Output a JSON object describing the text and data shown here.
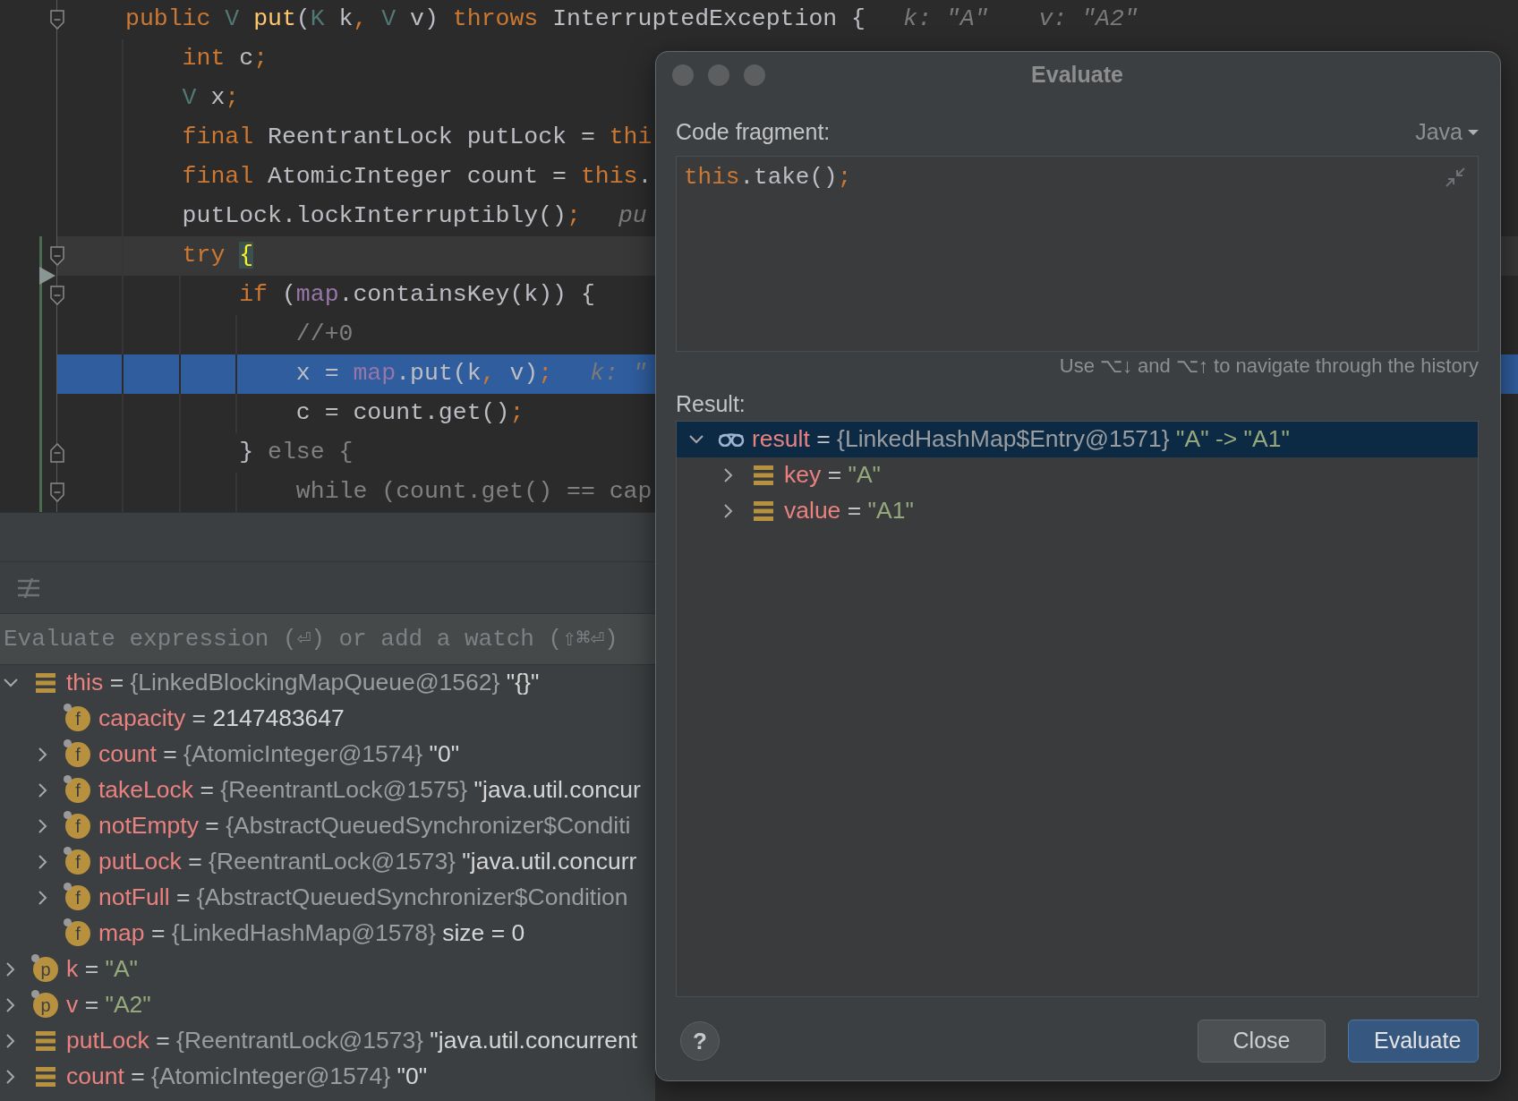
{
  "editor": {
    "lines": [
      {
        "tokens": [
          {
            "kind": "keyword",
            "text": "public "
          },
          {
            "kind": "type",
            "text": "V "
          },
          {
            "kind": "method",
            "text": "put"
          },
          {
            "kind": "plain",
            "text": "("
          },
          {
            "kind": "type",
            "text": "K"
          },
          {
            "kind": "plain",
            "text": " k"
          },
          {
            "kind": "punct",
            "text": ", "
          },
          {
            "kind": "type",
            "text": "V"
          },
          {
            "kind": "plain",
            "text": " v) "
          },
          {
            "kind": "keyword",
            "text": "throws"
          },
          {
            "kind": "plain",
            "text": " InterruptedException {"
          }
        ],
        "hints": [
          "k: \"A\"",
          "v: \"A2\""
        ],
        "fold_start": true,
        "fold_end": false,
        "current": false,
        "caret": false,
        "exec": false,
        "changed": false
      },
      {
        "tokens": [
          {
            "kind": "keyword",
            "text": "    int"
          },
          {
            "kind": "plain",
            "text": " c"
          },
          {
            "kind": "punct",
            "text": ";"
          }
        ],
        "fold_start": false,
        "fold_end": false,
        "current": false,
        "caret": false,
        "exec": false,
        "changed": false
      },
      {
        "tokens": [
          {
            "kind": "type",
            "text": "    V"
          },
          {
            "kind": "plain",
            "text": " x"
          },
          {
            "kind": "punct",
            "text": ";"
          }
        ],
        "fold_start": false,
        "fold_end": false,
        "current": false,
        "caret": false,
        "exec": false,
        "changed": false
      },
      {
        "tokens": [
          {
            "kind": "keyword",
            "text": "    final"
          },
          {
            "kind": "plain",
            "text": " ReentrantLock putLock = "
          },
          {
            "kind": "keyword",
            "text": "thi"
          }
        ],
        "fold_start": false,
        "fold_end": false,
        "current": false,
        "caret": false,
        "exec": false,
        "changed": false
      },
      {
        "tokens": [
          {
            "kind": "keyword",
            "text": "    final"
          },
          {
            "kind": "plain",
            "text": " AtomicInteger count = "
          },
          {
            "kind": "keyword",
            "text": "this"
          },
          {
            "kind": "plain",
            "text": "."
          }
        ],
        "fold_start": false,
        "fold_end": false,
        "current": false,
        "caret": false,
        "exec": false,
        "changed": false
      },
      {
        "tokens": [
          {
            "kind": "plain",
            "text": "    putLock.lockInterruptibly()"
          },
          {
            "kind": "punct",
            "text": ";"
          }
        ],
        "hints": [
          "pu"
        ],
        "fold_start": false,
        "fold_end": false,
        "current": false,
        "caret": false,
        "exec": false,
        "changed": false
      },
      {
        "tokens": [
          {
            "kind": "keyword",
            "text": "    try "
          },
          {
            "kind": "brace",
            "text": "{"
          }
        ],
        "fold_start": true,
        "fold_end": false,
        "current": false,
        "caret": true,
        "exec": true,
        "changed": true
      },
      {
        "tokens": [
          {
            "kind": "keyword",
            "text": "        if"
          },
          {
            "kind": "plain",
            "text": " ("
          },
          {
            "kind": "field",
            "text": "map"
          },
          {
            "kind": "plain",
            "text": ".containsKey(k)) {"
          }
        ],
        "fold_start": true,
        "fold_end": false,
        "current": false,
        "caret": false,
        "exec": false,
        "changed": true
      },
      {
        "tokens": [
          {
            "kind": "comment",
            "text": "            //+0"
          }
        ],
        "fold_start": false,
        "fold_end": false,
        "current": false,
        "caret": false,
        "exec": false,
        "changed": true
      },
      {
        "tokens": [
          {
            "kind": "plain",
            "text": "            x = "
          },
          {
            "kind": "field",
            "text": "map"
          },
          {
            "kind": "plain",
            "text": ".put(k"
          },
          {
            "kind": "punct",
            "text": ","
          },
          {
            "kind": "plain",
            "text": " v)"
          },
          {
            "kind": "punct",
            "text": ";"
          }
        ],
        "hints": [
          "k: \""
        ],
        "fold_start": false,
        "fold_end": false,
        "current": true,
        "caret": false,
        "exec": false,
        "changed": true
      },
      {
        "tokens": [
          {
            "kind": "plain",
            "text": "            c = count.get()"
          },
          {
            "kind": "punct",
            "text": ";"
          }
        ],
        "fold_start": false,
        "fold_end": false,
        "current": false,
        "caret": false,
        "exec": false,
        "changed": true
      },
      {
        "tokens": [
          {
            "kind": "plain",
            "text": "        } "
          },
          {
            "kind": "dim",
            "text": "else {"
          }
        ],
        "fold_start": false,
        "fold_end": true,
        "current": false,
        "caret": false,
        "exec": false,
        "changed": true
      },
      {
        "tokens": [
          {
            "kind": "dim",
            "text": "            while (count.get() == cap"
          }
        ],
        "fold_start": true,
        "fold_end": false,
        "current": false,
        "caret": false,
        "exec": false,
        "changed": true
      }
    ]
  },
  "debugger": {
    "eval_field": {
      "placeholder": "Evaluate expression (⏎) or add a watch (⇧⌘⏎)"
    },
    "variables": [
      {
        "icon": {
          "kind": "bars"
        },
        "name": "this",
        "sep": "=",
        "type": "{LinkedBlockingMapQueue@1562}",
        "value": "\"{}\"",
        "string": false,
        "expandable": true,
        "expanded": true,
        "selected": false,
        "children": [
          {
            "icon": {
              "kind": "letter",
              "letter": "f"
            },
            "name": "capacity",
            "sep": "=",
            "value": "2147483647",
            "string": false,
            "expandable": false,
            "selected": false
          },
          {
            "icon": {
              "kind": "letter",
              "letter": "f"
            },
            "name": "count",
            "sep": "=",
            "type": "{AtomicInteger@1574}",
            "value": "\"0\"",
            "string": false,
            "expandable": true,
            "expanded": false,
            "selected": false
          },
          {
            "icon": {
              "kind": "letter",
              "letter": "f"
            },
            "name": "takeLock",
            "sep": "=",
            "type": "{ReentrantLock@1575}",
            "value": "\"java.util.concur",
            "string": false,
            "expandable": true,
            "expanded": false,
            "selected": false
          },
          {
            "icon": {
              "kind": "letter",
              "letter": "f"
            },
            "name": "notEmpty",
            "sep": "=",
            "type": "{AbstractQueuedSynchronizer$Conditi",
            "expandable": true,
            "expanded": false,
            "selected": false
          },
          {
            "icon": {
              "kind": "letter",
              "letter": "f"
            },
            "name": "putLock",
            "sep": "=",
            "type": "{ReentrantLock@1573}",
            "value": "\"java.util.concurr",
            "string": false,
            "expandable": true,
            "expanded": false,
            "selected": false
          },
          {
            "icon": {
              "kind": "letter",
              "letter": "f"
            },
            "name": "notFull",
            "sep": "=",
            "type": "{AbstractQueuedSynchronizer$Condition",
            "expandable": true,
            "expanded": false,
            "selected": false
          },
          {
            "icon": {
              "kind": "letter",
              "letter": "f"
            },
            "name": "map",
            "sep": "=",
            "type": "{LinkedHashMap@1578}",
            "value": "size = 0",
            "string": false,
            "expandable": false,
            "selected": false
          }
        ]
      },
      {
        "icon": {
          "kind": "letter",
          "letter": "p"
        },
        "name": "k",
        "sep": "=",
        "value": "\"A\"",
        "string": true,
        "expandable": true,
        "expanded": false,
        "selected": false
      },
      {
        "icon": {
          "kind": "letter",
          "letter": "p"
        },
        "name": "v",
        "sep": "=",
        "value": "\"A2\"",
        "string": true,
        "expandable": true,
        "expanded": false,
        "selected": false
      },
      {
        "icon": {
          "kind": "bars"
        },
        "name": "putLock",
        "sep": "=",
        "type": "{ReentrantLock@1573}",
        "value": "\"java.util.concurrent",
        "string": false,
        "expandable": true,
        "expanded": false,
        "selected": false
      },
      {
        "icon": {
          "kind": "bars"
        },
        "name": "count",
        "sep": "=",
        "type": "{AtomicInteger@1574}",
        "value": "\"0\"",
        "string": false,
        "expandable": true,
        "expanded": false,
        "selected": false
      }
    ]
  },
  "dialog": {
    "title": "Evaluate",
    "code_label": "Code fragment:",
    "language": "Java",
    "code": [
      {
        "kind": "keyword",
        "text": "this"
      },
      {
        "kind": "plain",
        "text": ".take()"
      },
      {
        "kind": "punct",
        "text": ";"
      }
    ],
    "history_hint": "Use ⌥↓ and ⌥↑ to navigate through the history",
    "result_label": "Result:",
    "result": [
      {
        "icon": {
          "kind": "glasses"
        },
        "name": "result",
        "sep": "=",
        "type": "{LinkedHashMap$Entry@1571}",
        "value": "\"A\" -> \"A1\"",
        "string": true,
        "expandable": true,
        "expanded": true,
        "selected": true,
        "children": [
          {
            "icon": {
              "kind": "bars"
            },
            "name": "key",
            "sep": "=",
            "value": "\"A\"",
            "string": true,
            "expandable": true,
            "expanded": false,
            "selected": false
          },
          {
            "icon": {
              "kind": "bars"
            },
            "name": "value",
            "sep": "=",
            "value": "\"A1\"",
            "string": true,
            "expandable": true,
            "expanded": false,
            "selected": false
          }
        ]
      }
    ],
    "help": "?",
    "buttons": [
      {
        "label": "Close",
        "kind": "secondary"
      },
      {
        "label": "Evaluate",
        "kind": "primary"
      }
    ]
  }
}
